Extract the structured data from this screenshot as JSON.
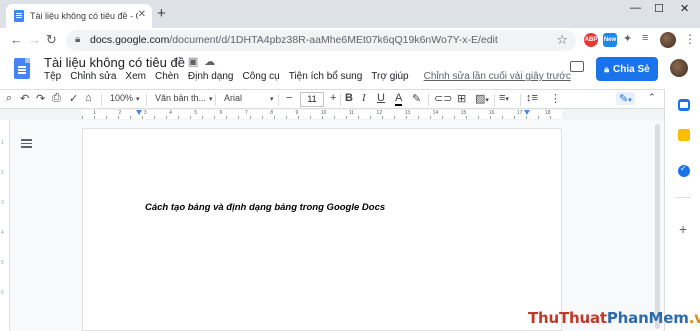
{
  "browser": {
    "tab_title": "Tài liệu không có tiêu đề - Goog",
    "url_host": "docs.google.com",
    "url_path": "/document/d/1DHTA4pbz38R-aaMhe6MEt07k6qQ19k6nWo7Y-x-E/edit",
    "ext_abp_label": "ABP",
    "ext_new_label": "New"
  },
  "docs": {
    "title": "Tài liệu không có tiêu đề",
    "menu": [
      "Tệp",
      "Chỉnh sửa",
      "Xem",
      "Chèn",
      "Định dạng",
      "Công cụ",
      "Tiện ích bổ sung",
      "Trợ giúp"
    ],
    "last_edit": "Chỉnh sửa lần cuối vài giây trước",
    "share_label": "Chia Sẻ"
  },
  "toolbar": {
    "zoom": "100%",
    "style": "Văn bản th...",
    "font": "Arial",
    "font_size": "11"
  },
  "ruler": {
    "numbers": [
      "1",
      "2",
      "3",
      "4",
      "5",
      "6",
      "7",
      "8",
      "9",
      "10",
      "11",
      "12",
      "13",
      "14",
      "15",
      "16",
      "17",
      "18"
    ]
  },
  "document": {
    "body_text": "Cách tạo bảng và định dạng bảng trong Google Docs"
  },
  "watermark": {
    "part1": "ThuThuat",
    "part2": "PhanMem",
    "part3": ".vn"
  },
  "colors": {
    "accent": "#1a73e8",
    "docs_blue": "#4285f4",
    "keep_yellow": "#fbbc04"
  }
}
